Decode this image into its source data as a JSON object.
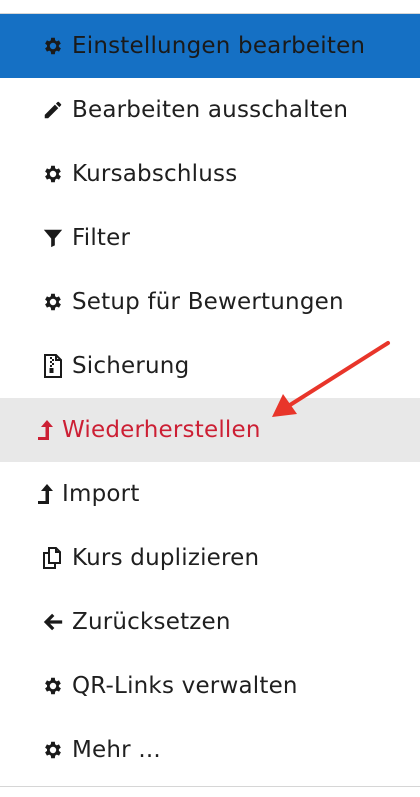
{
  "menu": {
    "items": [
      {
        "label": "Einstellungen bearbeiten",
        "icon": "gear-icon"
      },
      {
        "label": "Bearbeiten ausschalten",
        "icon": "pencil-icon"
      },
      {
        "label": "Kursabschluss",
        "icon": "gear-icon"
      },
      {
        "label": "Filter",
        "icon": "filter-icon"
      },
      {
        "label": "Setup für Bewertungen",
        "icon": "gear-icon"
      },
      {
        "label": "Sicherung",
        "icon": "archive-file-icon"
      },
      {
        "label": "Wiederherstellen",
        "icon": "upload-arrow-icon"
      },
      {
        "label": "Import",
        "icon": "upload-arrow-icon"
      },
      {
        "label": "Kurs duplizieren",
        "icon": "copy-icon"
      },
      {
        "label": "Zurücksetzen",
        "icon": "arrow-left-icon"
      },
      {
        "label": "QR-Links verwalten",
        "icon": "gear-icon"
      },
      {
        "label": "Mehr ...",
        "icon": "gear-icon"
      }
    ]
  },
  "colors": {
    "active_background": "#1570c4",
    "hover_background": "#e8e8e8",
    "hover_text": "#cc1f34",
    "annotation_arrow": "#e8352a"
  }
}
